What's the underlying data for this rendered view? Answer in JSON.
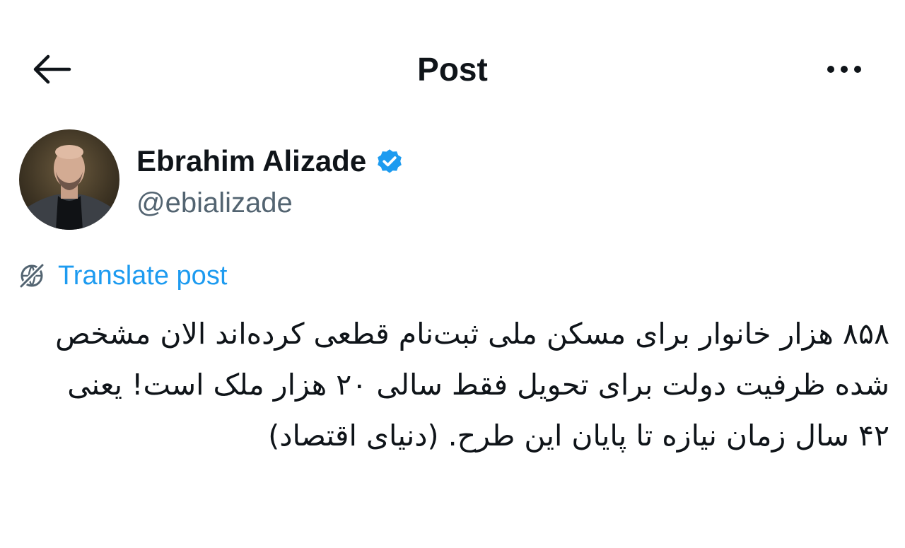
{
  "header": {
    "title": "Post",
    "back_icon": "arrow-left-icon",
    "more_icon": "more-horizontal-icon"
  },
  "author": {
    "name": "Ebrahim Alizade",
    "handle": "@ebializade",
    "verified_icon": "verified-badge-icon",
    "verified_color": "#1d9bf0"
  },
  "translate": {
    "label": "Translate post",
    "icon": "globe-slash-icon"
  },
  "post": {
    "text": "۸۵۸ هزار خانوار برای مسکن ملی ثبت‌نام قطعی کرده‌اند الان مشخص شده ظرفیت دولت برای تحویل فقط سالی ۲۰ هزار ملک است! یعنی ۴۲ سال زمان نیازه تا پایان این طرح. (دنیای اقتصاد)"
  },
  "colors": {
    "text_primary": "#0f1419",
    "text_secondary": "#536471",
    "accent": "#1d9bf0"
  }
}
